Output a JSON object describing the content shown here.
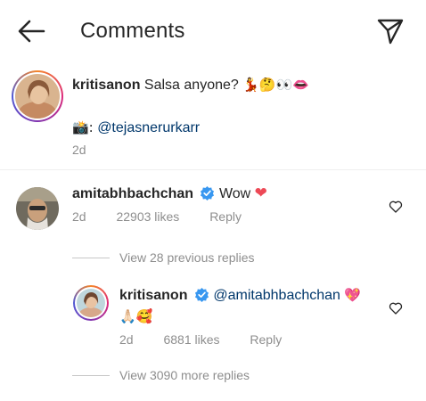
{
  "header": {
    "back_icon": "arrow-left-icon",
    "title": "Comments",
    "send_icon": "paper-plane-icon"
  },
  "post": {
    "username": "kritisanon",
    "caption": "Salsa anyone?",
    "caption_emojis": "💃🤔👀👄",
    "credit_prefix": "📸:",
    "credit_mention": "@tejasnerurkarr",
    "time": "2d"
  },
  "comment": {
    "username": "amitabhbachchan",
    "verified": true,
    "text": "Wow",
    "emoji": "❤",
    "time": "2d",
    "likes": "22903 likes",
    "reply_label": "Reply"
  },
  "view_previous": "View 28 previous replies",
  "reply": {
    "username": "kritisanon",
    "verified": true,
    "mention": "@amitabhbachchan",
    "emoji": "💖",
    "second_line_emojis": "🙏🏻🥰",
    "time": "2d",
    "likes": "6881 likes",
    "reply_label": "Reply"
  },
  "view_more": "View 3090 more replies",
  "colors": {
    "text": "#262626",
    "secondary": "#8e8e8e",
    "mention": "#00376b",
    "verified": "#3897f0",
    "heart": "#ed4956"
  }
}
